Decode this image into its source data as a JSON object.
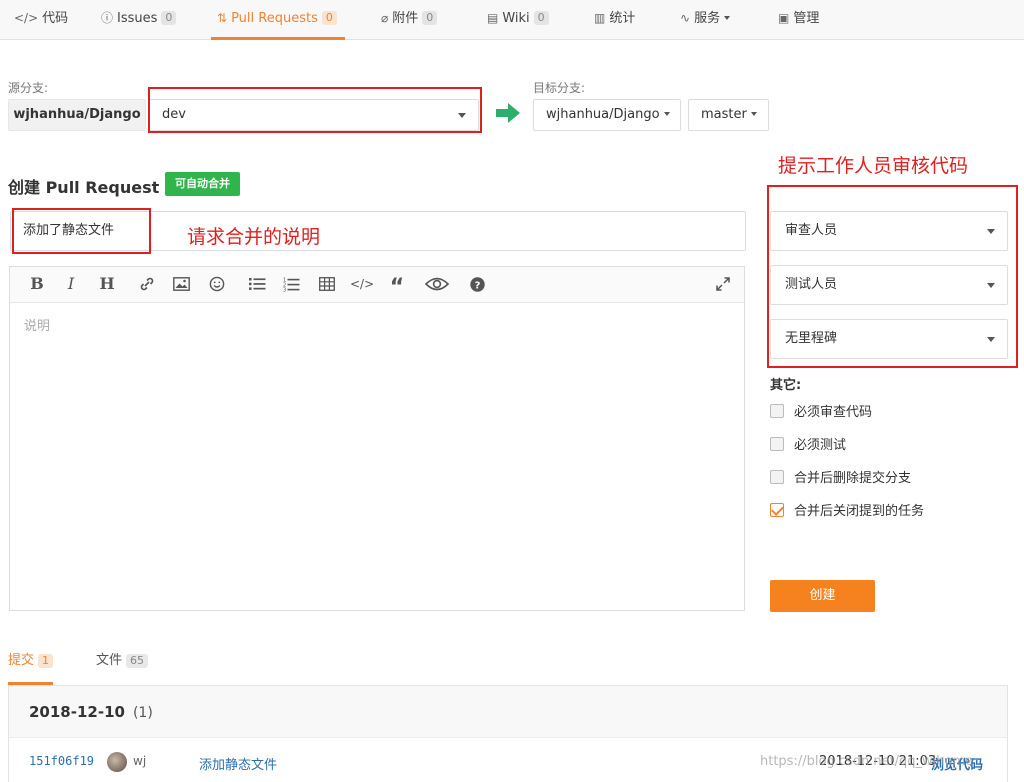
{
  "nav": {
    "tabs": [
      {
        "icon": "code-icon",
        "glyph": "</>",
        "label": "代码",
        "count": ""
      },
      {
        "icon": "issue-icon",
        "glyph": "ⓘ",
        "label": "Issues",
        "count": "0"
      },
      {
        "icon": "pull-request-icon",
        "glyph": "⇅",
        "label": "Pull Requests",
        "count": "0"
      },
      {
        "icon": "attachment-icon",
        "glyph": "∅",
        "label": "附件",
        "count": "0"
      },
      {
        "icon": "wiki-icon",
        "glyph": "▤",
        "label": "Wiki",
        "count": "0"
      },
      {
        "icon": "stats-icon",
        "glyph": "▥",
        "label": "统计",
        "count": ""
      },
      {
        "icon": "service-icon",
        "glyph": "∿",
        "label": "服务",
        "count": ""
      },
      {
        "icon": "manage-icon",
        "glyph": "▣",
        "label": "管理",
        "count": ""
      }
    ]
  },
  "branch": {
    "source_label": "源分支:",
    "target_label": "目标分支:",
    "source_repo": "wjhanhua/Django",
    "source_branch": "dev",
    "target_repo": "wjhanhua/Django",
    "target_branch": "master"
  },
  "form": {
    "title": "创建 Pull Request",
    "merge_badge": "可自动合并",
    "pr_title_value": "添加了静态文件",
    "description_placeholder": "说明",
    "toolbar": [
      "B",
      "I",
      "H",
      "link",
      "image",
      "emoji",
      "ul",
      "ol",
      "table",
      "code",
      "quote",
      "preview",
      "help",
      "fullscreen"
    ]
  },
  "annotations": {
    "reviewers": "提示工作人员审核代码",
    "description": "请求合并的说明"
  },
  "sidebar": {
    "reviewers": "审查人员",
    "testers": "测试人员",
    "milestone": "无里程碑",
    "other_label": "其它:",
    "options": [
      {
        "label": "必须审查代码",
        "checked": false
      },
      {
        "label": "必须测试",
        "checked": false
      },
      {
        "label": "合并后删除提交分支",
        "checked": false
      },
      {
        "label": "合并后关闭提到的任务",
        "checked": true
      }
    ],
    "create_button": "创建"
  },
  "bottom_tabs": [
    {
      "label": "提交",
      "count": "1"
    },
    {
      "label": "文件",
      "count": "65"
    }
  ],
  "commits": {
    "date": "2018-12-10",
    "count": "(1)",
    "rows": [
      {
        "sha": "151f06f19",
        "author": "wj",
        "message": "添加静态文件",
        "time": "2018-12-10 21:03",
        "browse": "浏览代码"
      }
    ]
  },
  "watermark": "https://blog.csdn.net/qq_wjhome"
}
